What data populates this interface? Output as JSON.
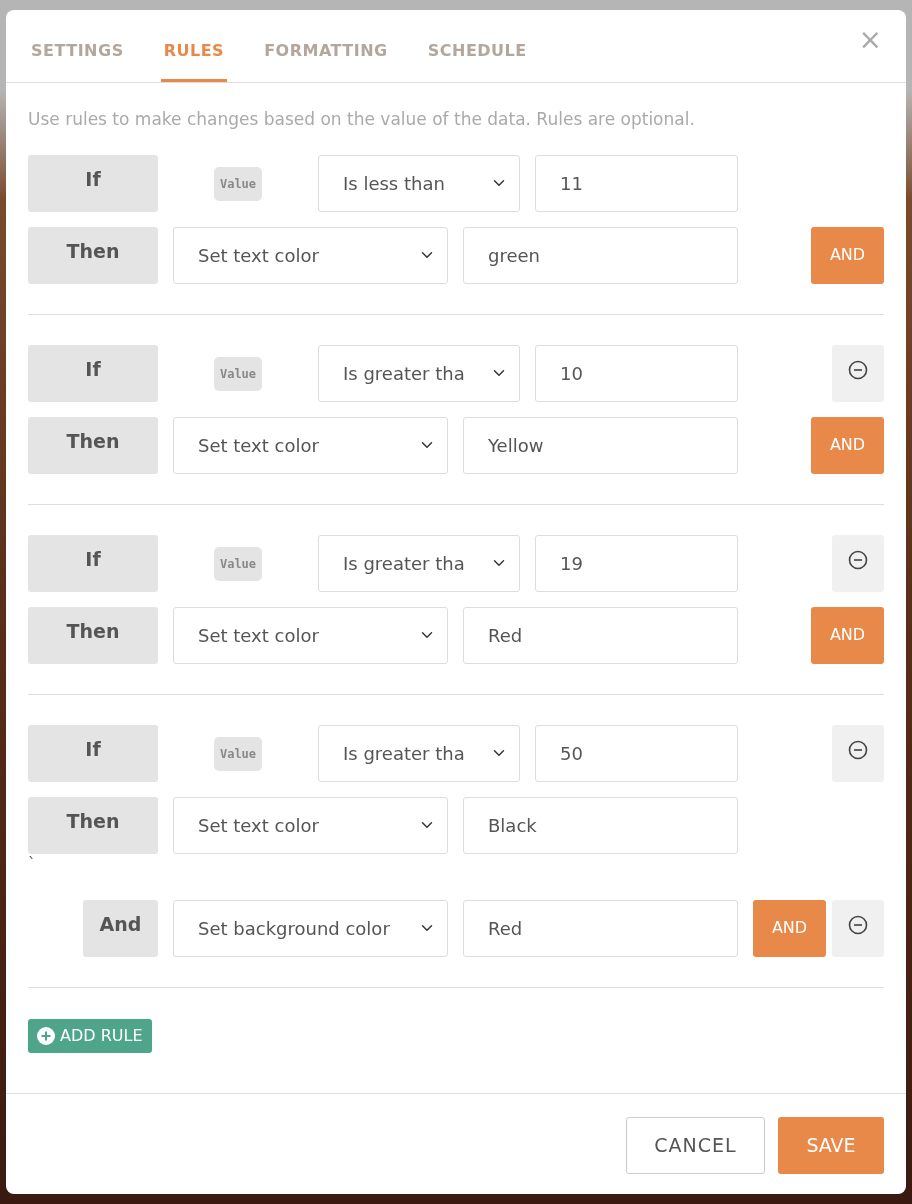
{
  "tabs": [
    {
      "label": "SETTINGS",
      "selected": false
    },
    {
      "label": "RULES",
      "selected": true
    },
    {
      "label": "FORMATTING",
      "selected": false
    },
    {
      "label": "SCHEDULE",
      "selected": false
    }
  ],
  "close": "×",
  "description": "Use rules to make changes based on the value of the data. Rules are optional.",
  "rules": [
    {
      "if_label": "If",
      "field": "Value",
      "operator": "Is less than",
      "value": "11",
      "removable": false,
      "actions": [
        {
          "kind": "then",
          "label": "Then",
          "action": "Set text color",
          "value": "green",
          "and_button": "AND",
          "removable": false
        }
      ]
    },
    {
      "if_label": "If",
      "field": "Value",
      "operator": "Is greater tha",
      "value": "10",
      "removable": true,
      "actions": [
        {
          "kind": "then",
          "label": "Then",
          "action": "Set text color",
          "value": "Yellow",
          "and_button": "AND",
          "removable": false
        }
      ]
    },
    {
      "if_label": "If",
      "field": "Value",
      "operator": "Is greater tha",
      "value": "19",
      "removable": true,
      "actions": [
        {
          "kind": "then",
          "label": "Then",
          "action": "Set text color",
          "value": "Red",
          "and_button": "AND",
          "removable": false
        }
      ]
    },
    {
      "if_label": "If",
      "field": "Value",
      "operator": "Is greater tha",
      "value": "50",
      "removable": true,
      "actions": [
        {
          "kind": "then",
          "label": "Then",
          "action": "Set text color",
          "value": "Black",
          "trailing_mark": "`",
          "removable": false
        },
        {
          "kind": "and",
          "label": "And",
          "action": "Set background color",
          "value": "Red",
          "and_button": "AND",
          "removable": true
        }
      ]
    }
  ],
  "add_rule": "ADD RULE",
  "footer": {
    "cancel": "CANCEL",
    "save": "SAVE"
  }
}
